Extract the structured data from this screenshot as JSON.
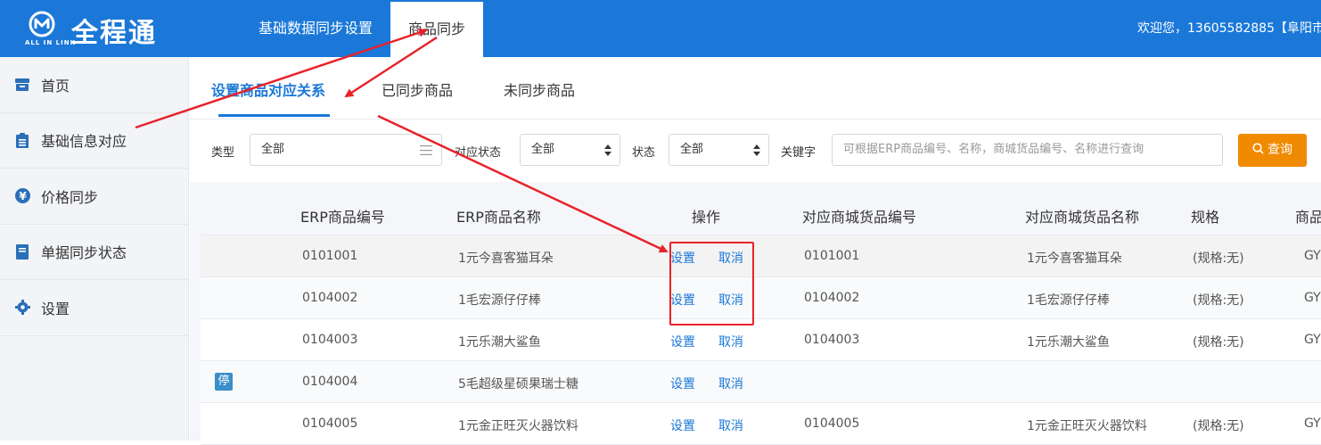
{
  "app": {
    "logo_text": "全程通",
    "logo_sub": "ALL IN LINK",
    "welcome": "欢迎您，13605582885【阜阳市"
  },
  "topnav": {
    "items": [
      {
        "label": "基础数据同步设置"
      },
      {
        "label": "商品同步"
      }
    ],
    "active_index": 1
  },
  "sidebar": {
    "items": [
      {
        "label": "首页",
        "icon": "home-icon"
      },
      {
        "label": "基础信息对应",
        "icon": "clipboard-icon"
      },
      {
        "label": "价格同步",
        "icon": "yen-icon"
      },
      {
        "label": "单据同步状态",
        "icon": "bookmark-icon"
      },
      {
        "label": "设置",
        "icon": "gear-icon"
      }
    ]
  },
  "tabs": {
    "items": [
      {
        "label": "设置商品对应关系"
      },
      {
        "label": "已同步商品"
      },
      {
        "label": "未同步商品"
      }
    ],
    "active_index": 0
  },
  "filter": {
    "type_label": "类型",
    "type_value": "全部",
    "match_status_label": "对应状态",
    "match_status_value": "全部",
    "status_label": "状态",
    "status_value": "全部",
    "keyword_label": "关键字",
    "keyword_placeholder": "可根据ERP商品编号、名称，商城货品编号、名称进行查询",
    "query_button": "查询"
  },
  "table": {
    "columns": [
      "ERP商品编号",
      "ERP商品名称",
      "操作",
      "对应商城货品编号",
      "对应商城货品名称",
      "规格",
      "商品"
    ],
    "rows": [
      {
        "badge": "",
        "erp_code": "0101001",
        "erp_name": "1元今喜客猫耳朵",
        "op_set": "设置",
        "op_cancel": "取消",
        "mall_code": "0101001",
        "mall_name": "1元今喜客猫耳朵",
        "spec": "(规格:无)",
        "extra": "GY"
      },
      {
        "badge": "",
        "erp_code": "0104002",
        "erp_name": "1毛宏源仔仔棒",
        "op_set": "设置",
        "op_cancel": "取消",
        "mall_code": "0104002",
        "mall_name": "1毛宏源仔仔棒",
        "spec": "(规格:无)",
        "extra": "GY"
      },
      {
        "badge": "",
        "erp_code": "0104003",
        "erp_name": "1元乐潮大鲨鱼",
        "op_set": "设置",
        "op_cancel": "取消",
        "mall_code": "0104003",
        "mall_name": "1元乐潮大鲨鱼",
        "spec": "(规格:无)",
        "extra": "GY"
      },
      {
        "badge": "停",
        "erp_code": "0104004",
        "erp_name": "5毛超级星硕果瑞士糖",
        "op_set": "设置",
        "op_cancel": "取消",
        "mall_code": "",
        "mall_name": "",
        "spec": "",
        "extra": ""
      },
      {
        "badge": "",
        "erp_code": "0104005",
        "erp_name": "1元金正旺灭火器饮料",
        "op_set": "设置",
        "op_cancel": "取消",
        "mall_code": "0104005",
        "mall_name": "1元金正旺灭火器饮料",
        "spec": "(规格:无)",
        "extra": "GY"
      }
    ]
  },
  "colors": {
    "brand": "#1b78d8",
    "query_button": "#f08a00",
    "annotation": "#e8222a"
  }
}
